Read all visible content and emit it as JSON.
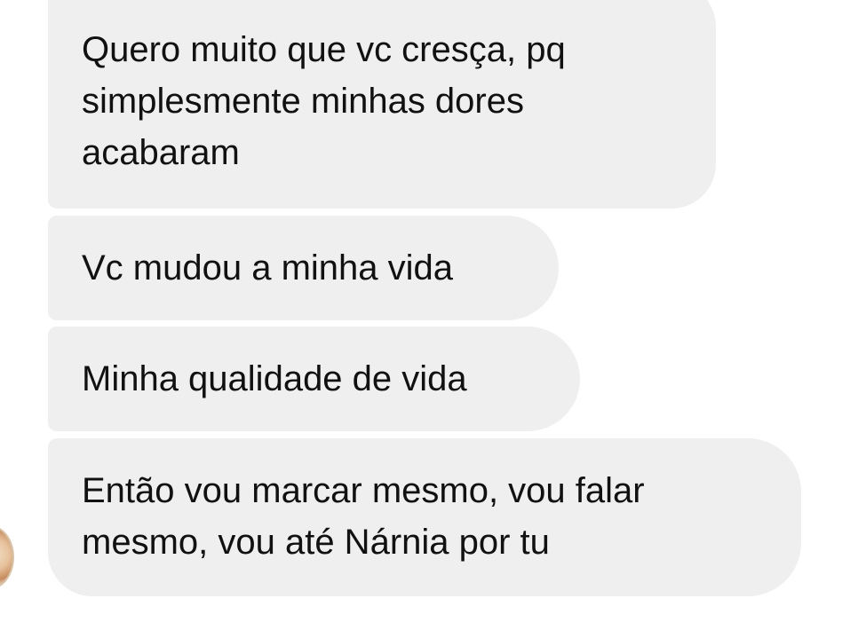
{
  "messages": [
    {
      "lines": [
        "Quero muito que vc cresça, pq",
        "simplesmente minhas dores",
        "acabaram"
      ]
    },
    {
      "lines": [
        "Vc mudou a minha vida"
      ]
    },
    {
      "lines": [
        "Minha qualidade de vida"
      ]
    },
    {
      "lines": [
        "Então vou marcar mesmo, vou falar",
        "mesmo, vou até Nárnia por tu"
      ]
    }
  ],
  "colors": {
    "bubble_background": "#efefef",
    "text": "#111111",
    "page_background": "#ffffff"
  },
  "icons": {
    "sender_avatar": "avatar-icon"
  }
}
